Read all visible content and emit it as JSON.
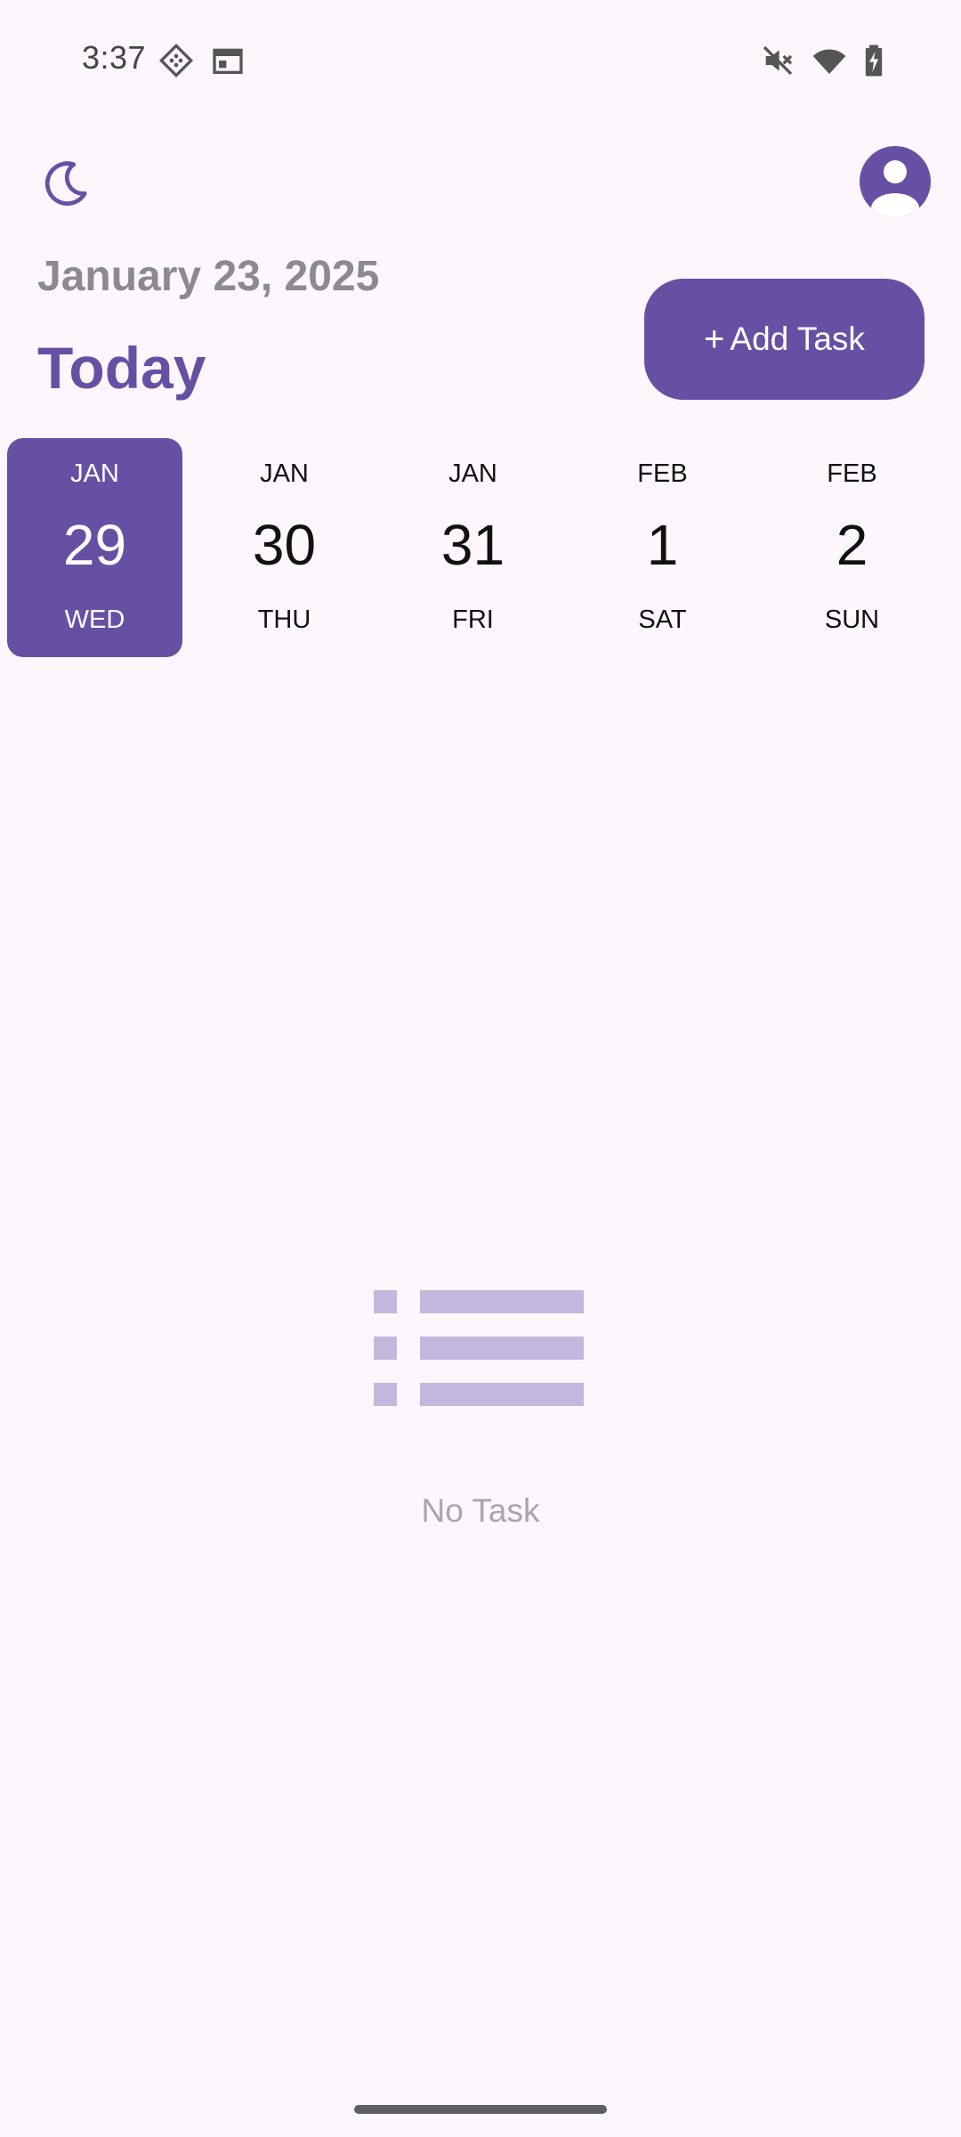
{
  "status_bar": {
    "time": "3:37",
    "left_icons": [
      "vpn-key-icon",
      "calendar-icon"
    ],
    "right_icons": [
      "mute-icon",
      "wifi-icon",
      "battery-charging-icon"
    ]
  },
  "header": {
    "theme_toggle_icon": "moon-icon",
    "profile_icon": "account-circle-icon",
    "date": "January 23, 2025",
    "title": "Today",
    "add_button": {
      "plus": "+",
      "label": "Add Task"
    }
  },
  "date_strip": [
    {
      "month": "JAN",
      "day": "29",
      "weekday": "WED",
      "selected": true
    },
    {
      "month": "JAN",
      "day": "30",
      "weekday": "THU",
      "selected": false
    },
    {
      "month": "JAN",
      "day": "31",
      "weekday": "FRI",
      "selected": false
    },
    {
      "month": "FEB",
      "day": "1",
      "weekday": "SAT",
      "selected": false
    },
    {
      "month": "FEB",
      "day": "2",
      "weekday": "SUN",
      "selected": false
    }
  ],
  "empty_state": {
    "icon": "list-icon",
    "message": "No Task"
  },
  "colors": {
    "primary": "#6750A4",
    "background": "#FDF6FC",
    "muted_text": "#8C8A8E",
    "empty_icon": "#C4B7DE"
  }
}
